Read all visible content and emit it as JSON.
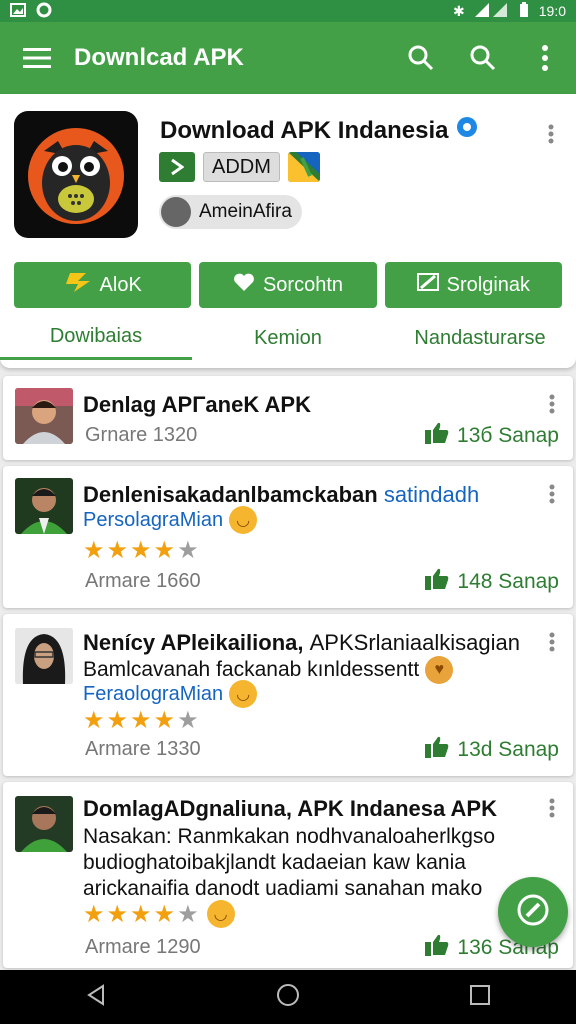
{
  "status_bar": {
    "time": "19:0"
  },
  "app_bar": {
    "title": "Downlcad APK",
    "icons": [
      "menu-icon",
      "search-icon",
      "search-icon",
      "more-vert-icon"
    ]
  },
  "app": {
    "name": "Download APK Indanesia",
    "tag_label": "ADDM",
    "author": "AmeinAfira"
  },
  "actions": [
    {
      "label": "AloK",
      "icon": "bolt-icon"
    },
    {
      "label": "Sorcohtn",
      "icon": "heart-icon"
    },
    {
      "label": "Srolginak",
      "icon": "edit-icon"
    }
  ],
  "tabs": [
    {
      "label": "Dowibaias",
      "active": true
    },
    {
      "label": "Kemion",
      "active": false
    },
    {
      "label": "Nandasturarse",
      "active": false
    }
  ],
  "reviews": [
    {
      "name": "Denlag APΓaneK APK",
      "meta": "Grnare 1320",
      "likes": "13б Sanap"
    },
    {
      "name": "Denlenisakadanlbamckaban",
      "name_highlight": "satindadh",
      "sub": "PersolagraMian",
      "rating": 4,
      "meta": "Armare 1660",
      "likes": "148 Sanap"
    },
    {
      "name": "Nenícy APleikailiona,",
      "name_rest": "APKSrlaniaalkisagian",
      "text": "Bamlcavanah fackanab kınldessentt",
      "sub": "FeraolograMian",
      "rating": 4,
      "meta": "Armare 1330",
      "likes": "13d Sanap"
    },
    {
      "name": "DomlagADgnaliuna, APK Indanesa APK",
      "text_lines": [
        "Nasakan: Ranmkakan nodhvanaloaherlkgso",
        "budioghatoibakjlandt kadaeian kaw kania",
        "arickanaifia danodt uadiami sanahan mako"
      ],
      "rating": 4,
      "meta": "Armare 1290",
      "likes": "136 Sanap"
    }
  ],
  "colors": {
    "primary": "#43a047",
    "primary_dark": "#2f8f43",
    "link": "#1565c0",
    "star": "#f2a010"
  }
}
